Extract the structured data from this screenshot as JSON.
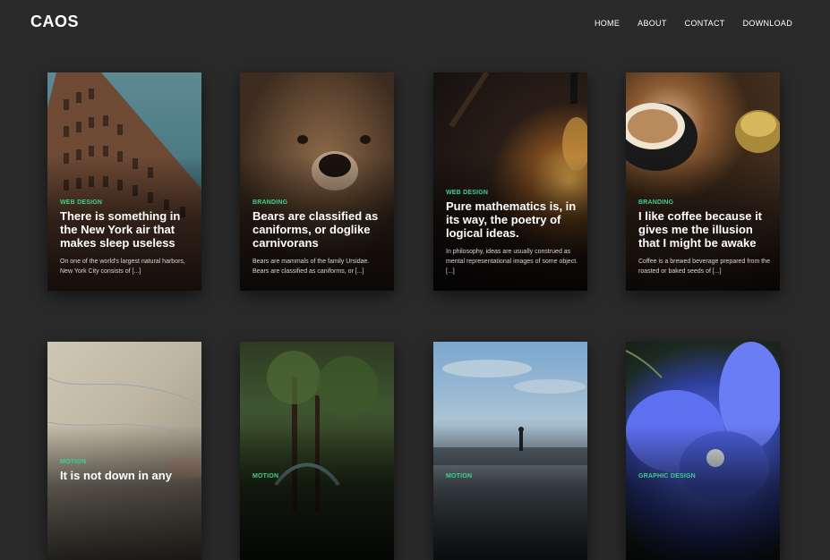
{
  "brand": "CAOS",
  "nav": [
    "HOME",
    "ABOUT",
    "CONTACT",
    "DOWNLOAD"
  ],
  "cards": [
    {
      "category": "WEB DESIGN",
      "title": "There is something in the New York air that makes sleep useless",
      "excerpt": "On one of the world's largest natural harbors, New York City consists of [...]",
      "image": "flatiron-building-photo"
    },
    {
      "category": "BRANDING",
      "title": "Bears are classified as caniforms, or doglike carnivorans",
      "excerpt": "Bears are mammals of the family Ursidae. Bears are classified as caniforms, or [...]",
      "image": "bear-photo"
    },
    {
      "category": "WEB DESIGN",
      "title": "Pure mathematics is, in its way, the poetry of logical ideas.",
      "excerpt": "In philosophy, ideas are usually construed as mental representational images of some object. [...]",
      "image": "light-bulb-photo"
    },
    {
      "category": "BRANDING",
      "title": "I like coffee because it gives me the illusion that I might be awake",
      "excerpt": "Coffee is a brewed beverage prepared from the roasted or baked seeds of [...]",
      "image": "coffee-cup-photo"
    },
    {
      "category": "MOTION",
      "title": "It is not down in any",
      "excerpt": "",
      "image": "map-photo"
    },
    {
      "category": "MOTION",
      "title": "",
      "excerpt": "",
      "image": "forest-photo"
    },
    {
      "category": "MOTION",
      "title": "",
      "excerpt": "",
      "image": "rainy-street-photo"
    },
    {
      "category": "GRAPHIC DESIGN",
      "title": "",
      "excerpt": "",
      "image": "blue-flower-photo"
    }
  ]
}
